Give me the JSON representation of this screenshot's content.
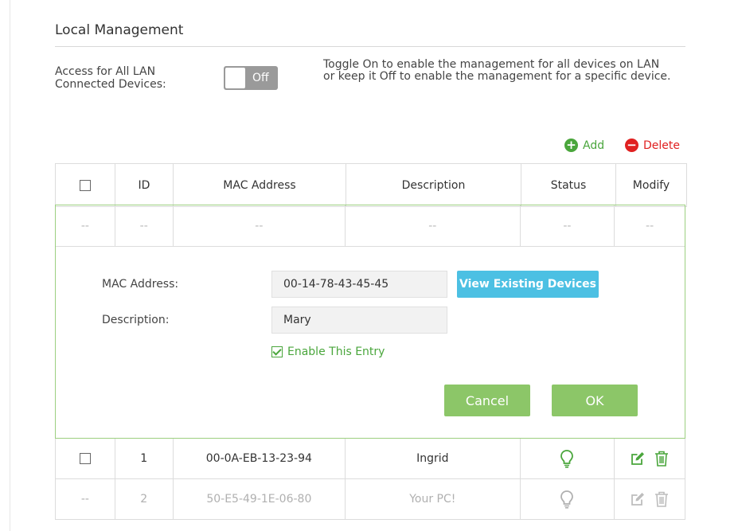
{
  "section": {
    "title": "Local Management",
    "access_label": "Access for All LAN Connected Devices:",
    "toggle_state": "Off",
    "help_text": "Toggle On to enable the management for all devices on LAN or keep it Off to enable the management for a specific device."
  },
  "actions": {
    "add_label": "Add",
    "delete_label": "Delete"
  },
  "table": {
    "headers": [
      "",
      "ID",
      "MAC Address",
      "Description",
      "Status",
      "Modify"
    ],
    "placeholder": [
      "--",
      "--",
      "--",
      "--",
      "--",
      "--"
    ],
    "rows": [
      {
        "checkbox": "",
        "id": "1",
        "mac": "00-0A-EB-13-23-94",
        "description": "Ingrid",
        "status": "bulb-icon",
        "active": true
      },
      {
        "checkbox": "--",
        "id": "2",
        "mac": "50-E5-49-1E-06-80",
        "description": "Your PC!",
        "status": "bulb-icon",
        "active": false
      }
    ]
  },
  "form": {
    "mac_label": "MAC Address:",
    "mac_value": "00-14-78-43-45-45",
    "view_button": "View Existing Devices",
    "desc_label": "Description:",
    "desc_value": "Mary",
    "enable_label": "Enable This Entry",
    "enable_checked": true,
    "cancel_label": "Cancel",
    "ok_label": "OK"
  },
  "colors": {
    "green": "#4aa63c",
    "red": "#e02020",
    "blue": "#4cc0e3",
    "button_green": "#8cc668"
  }
}
